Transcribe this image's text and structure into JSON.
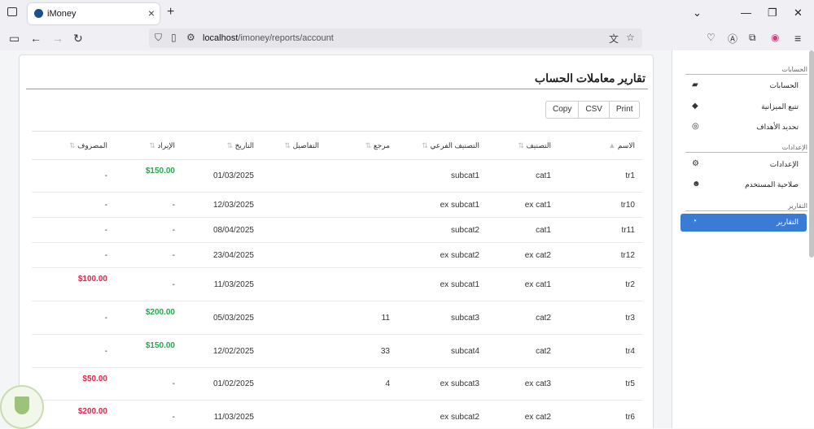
{
  "browser": {
    "tab_title": "iMoney",
    "url_host": "localhost",
    "url_path": "/imoney/reports/account"
  },
  "sidebar": {
    "sections": [
      {
        "label": "الحسابات"
      },
      {
        "label": "الإعدادات"
      },
      {
        "label": "التقارير"
      }
    ],
    "items": [
      {
        "label": "الحسابات",
        "icon": "folder-open-icon"
      },
      {
        "label": "تتبع الميزانية",
        "icon": "tags-icon"
      },
      {
        "label": "تحديد الأهداف",
        "icon": "life-ring-icon"
      },
      {
        "label": "الإعدادات",
        "icon": "gear-icon"
      },
      {
        "label": "صلاحية المستخدم",
        "icon": "users-icon"
      },
      {
        "label": "التقارير",
        "icon": "pie-chart-icon",
        "active": true
      }
    ]
  },
  "report": {
    "title": "تقارير معاملات الحساب",
    "buttons": {
      "copy": "Copy",
      "csv": "CSV",
      "print": "Print"
    },
    "columns": {
      "name": "الاسم",
      "category": "التصنيف",
      "subcategory": "التصنيف الفرعي",
      "reference": "مرجع",
      "details": "التفاصيل",
      "date": "التاريخ",
      "income": "الإيراد",
      "expense": "المصروف"
    },
    "rows": [
      {
        "name": "tr1",
        "category": "cat1",
        "subcategory": "subcat1",
        "reference": "",
        "details": "",
        "date": "01/03/2025",
        "income": "$150.00",
        "expense": "-"
      },
      {
        "name": "tr10",
        "category": "ex cat1",
        "subcategory": "ex subcat1",
        "reference": "",
        "details": "",
        "date": "12/03/2025",
        "income": "-",
        "expense": "-"
      },
      {
        "name": "tr11",
        "category": "cat1",
        "subcategory": "subcat2",
        "reference": "",
        "details": "",
        "date": "08/04/2025",
        "income": "-",
        "expense": "-"
      },
      {
        "name": "tr12",
        "category": "ex cat2",
        "subcategory": "ex subcat2",
        "reference": "",
        "details": "",
        "date": "23/04/2025",
        "income": "-",
        "expense": "-"
      },
      {
        "name": "tr2",
        "category": "ex cat1",
        "subcategory": "ex subcat1",
        "reference": "",
        "details": "",
        "date": "11/03/2025",
        "income": "-",
        "expense": "$100.00"
      },
      {
        "name": "tr3",
        "category": "cat2",
        "subcategory": "subcat3",
        "reference": "11",
        "details": "",
        "date": "05/03/2025",
        "income": "$200.00",
        "expense": "-"
      },
      {
        "name": "tr4",
        "category": "cat2",
        "subcategory": "subcat4",
        "reference": "33",
        "details": "",
        "date": "12/02/2025",
        "income": "$150.00",
        "expense": "-"
      },
      {
        "name": "tr5",
        "category": "ex cat3",
        "subcategory": "ex subcat3",
        "reference": "4",
        "details": "",
        "date": "01/02/2025",
        "income": "-",
        "expense": "$50.00"
      },
      {
        "name": "tr6",
        "category": "ex cat2",
        "subcategory": "ex subcat2",
        "reference": "",
        "details": "",
        "date": "11/03/2025",
        "income": "-",
        "expense": "$200.00"
      }
    ]
  }
}
